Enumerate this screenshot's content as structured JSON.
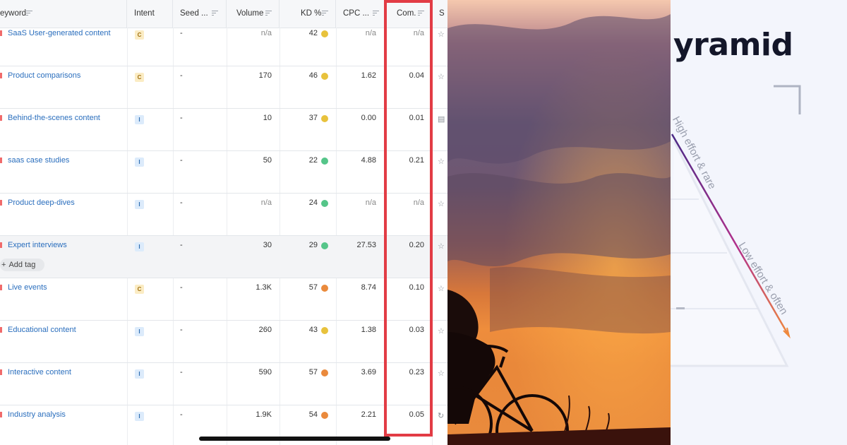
{
  "table": {
    "columns": [
      "eyword",
      "Intent",
      "Seed ...",
      "Volume",
      "KD %",
      "CPC ...",
      "Com.",
      "S"
    ],
    "add_tag_label": "Add tag",
    "rows": [
      {
        "keyword": "SaaS User-generated content",
        "intent": "C",
        "seed": "-",
        "volume": "n/a",
        "kd": "42",
        "kd_color": "#e8c23c",
        "cpc": "n/a",
        "com": "n/a"
      },
      {
        "keyword": "Product comparisons",
        "intent": "C",
        "seed": "-",
        "volume": "170",
        "kd": "46",
        "kd_color": "#e8c23c",
        "cpc": "1.62",
        "com": "0.04"
      },
      {
        "keyword": "Behind-the-scenes content",
        "intent": "I",
        "seed": "-",
        "volume": "10",
        "kd": "37",
        "kd_color": "#e8c23c",
        "cpc": "0.00",
        "com": "0.01"
      },
      {
        "keyword": "saas case studies",
        "intent": "I",
        "seed": "-",
        "volume": "50",
        "kd": "22",
        "kd_color": "#55c589",
        "cpc": "4.88",
        "com": "0.21"
      },
      {
        "keyword": "Product deep-dives",
        "intent": "I",
        "seed": "-",
        "volume": "n/a",
        "kd": "24",
        "kd_color": "#55c589",
        "cpc": "n/a",
        "com": "n/a"
      },
      {
        "keyword": "Expert interviews",
        "intent": "I",
        "seed": "-",
        "volume": "30",
        "kd": "29",
        "kd_color": "#55c589",
        "cpc": "27.53",
        "com": "0.20"
      },
      {
        "keyword": "Live events",
        "intent": "C",
        "seed": "-",
        "volume": "1.3K",
        "kd": "57",
        "kd_color": "#ea8a3c",
        "cpc": "8.74",
        "com": "0.10"
      },
      {
        "keyword": "Educational content",
        "intent": "I",
        "seed": "-",
        "volume": "260",
        "kd": "43",
        "kd_color": "#e8c23c",
        "cpc": "1.38",
        "com": "0.03"
      },
      {
        "keyword": "Interactive content",
        "intent": "I",
        "seed": "-",
        "volume": "590",
        "kd": "57",
        "kd_color": "#ea8a3c",
        "cpc": "3.69",
        "com": "0.23"
      },
      {
        "keyword": "Industry analysis",
        "intent": "I",
        "seed": "-",
        "volume": "1.9K",
        "kd": "54",
        "kd_color": "#ea8a3c",
        "cpc": "2.21",
        "com": "0.05"
      }
    ],
    "action_icons": [
      "star-icon",
      "star-icon",
      "document-icon",
      "star-icon",
      "star-icon",
      "star-icon",
      "star-icon",
      "star-icon",
      "star-icon",
      "refresh-icon"
    ],
    "highlight_color": "#e23c45"
  },
  "pyramid": {
    "title": "yramid",
    "label_high": "High effort & rare",
    "label_low": "Low effort & often"
  }
}
